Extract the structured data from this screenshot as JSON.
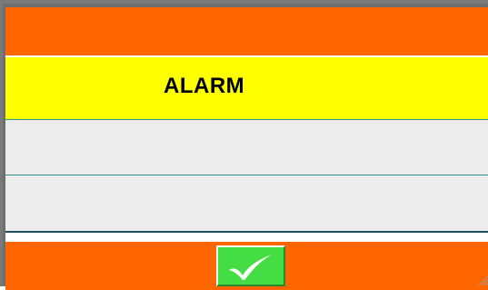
{
  "dialog": {
    "title": "ALARM",
    "message_lines": [
      "",
      ""
    ],
    "confirm_button": {
      "icon": "checkmark-icon"
    },
    "colors": {
      "header_footer": "#ff6600",
      "title_band": "#ffff00",
      "message_bg": "#ececec",
      "confirm_button": "#44dd44"
    }
  }
}
